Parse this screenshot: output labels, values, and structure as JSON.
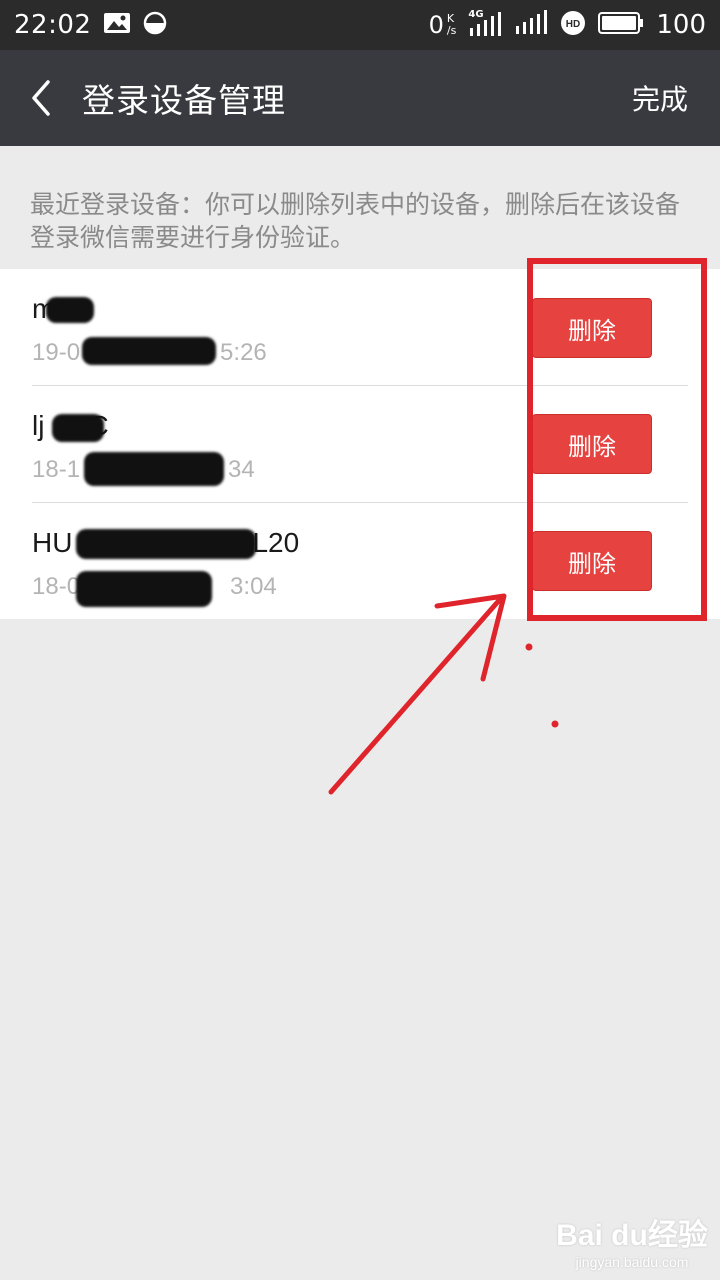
{
  "status_bar": {
    "time": "22:02",
    "net_speed": "0",
    "net_unit_top": "K",
    "net_unit_bottom": "/s",
    "network_type": "4G",
    "battery": "100",
    "icons": [
      "image-icon",
      "data-saver-icon",
      "signal-4g-icon",
      "signal-icon",
      "hd-icon",
      "battery-icon"
    ]
  },
  "header": {
    "back_icon": "chevron-left-icon",
    "title": "登录设备管理",
    "done_label": "完成"
  },
  "hint": "最近登录设备：你可以删除列表中的设备，删除后在该设备登录微信需要进行身份验证。",
  "devices": [
    {
      "name": "m",
      "time": "19-0",
      "time_tail": "5:26",
      "delete_label": "删除"
    },
    {
      "name": "lj",
      "name_tail": "C",
      "time": "18-1",
      "time_tail": "34",
      "delete_label": "删除"
    },
    {
      "name": "HU",
      "name_tail": "L20",
      "time": "18-0",
      "time_tail": "3:04",
      "delete_label": "删除"
    }
  ],
  "colors": {
    "status_bar": "#2b2b2b",
    "title_bar": "#393a3f",
    "background": "#ebebeb",
    "delete_button": "#e64340",
    "annotation": "#e0242b"
  },
  "watermark": {
    "main": "Bai du经验",
    "sub": "jingyan.baidu.com"
  }
}
